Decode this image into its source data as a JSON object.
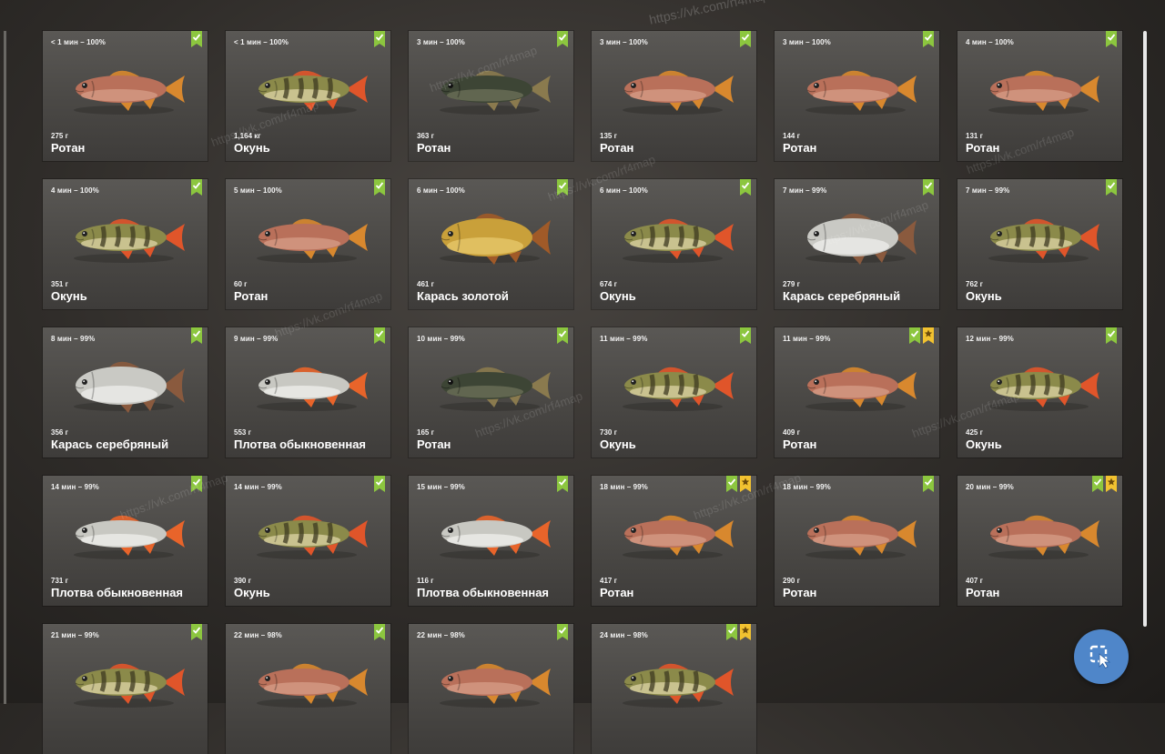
{
  "watermark": "https://vk.com/rf4map",
  "cards": [
    {
      "time": "< 1 мин – 100%",
      "weight": "275 г",
      "name": "Ротан",
      "species": "rotan",
      "star": false
    },
    {
      "time": "< 1 мин – 100%",
      "weight": "1,164 кг",
      "name": "Окунь",
      "species": "perch",
      "star": false
    },
    {
      "time": "3 мин – 100%",
      "weight": "363 г",
      "name": "Ротан",
      "species": "rotan-dark",
      "star": false
    },
    {
      "time": "3 мин – 100%",
      "weight": "135 г",
      "name": "Ротан",
      "species": "rotan",
      "star": false
    },
    {
      "time": "3 мин – 100%",
      "weight": "144 г",
      "name": "Ротан",
      "species": "rotan",
      "star": false
    },
    {
      "time": "4 мин – 100%",
      "weight": "131 г",
      "name": "Ротан",
      "species": "rotan",
      "star": false
    },
    {
      "time": "4 мин – 100%",
      "weight": "351 г",
      "name": "Окунь",
      "species": "perch",
      "star": false
    },
    {
      "time": "5 мин – 100%",
      "weight": "60 г",
      "name": "Ротан",
      "species": "rotan",
      "star": false
    },
    {
      "time": "6 мин – 100%",
      "weight": "461 г",
      "name": "Карась золотой",
      "species": "gold-carp",
      "star": false
    },
    {
      "time": "6 мин – 100%",
      "weight": "674 г",
      "name": "Окунь",
      "species": "perch",
      "star": false
    },
    {
      "time": "7 мин – 99%",
      "weight": "279 г",
      "name": "Карась серебряный",
      "species": "silver-carp",
      "star": false
    },
    {
      "time": "7 мин – 99%",
      "weight": "762 г",
      "name": "Окунь",
      "species": "perch",
      "star": false
    },
    {
      "time": "8 мин – 99%",
      "weight": "356 г",
      "name": "Карась серебряный",
      "species": "silver-carp",
      "star": false
    },
    {
      "time": "9 мин – 99%",
      "weight": "553 г",
      "name": "Плотва обыкновенная",
      "species": "roach",
      "star": false
    },
    {
      "time": "10 мин – 99%",
      "weight": "165 г",
      "name": "Ротан",
      "species": "rotan-dark",
      "star": false
    },
    {
      "time": "11 мин – 99%",
      "weight": "730 г",
      "name": "Окунь",
      "species": "perch",
      "star": false
    },
    {
      "time": "11 мин – 99%",
      "weight": "409 г",
      "name": "Ротан",
      "species": "rotan",
      "star": true
    },
    {
      "time": "12 мин – 99%",
      "weight": "425 г",
      "name": "Окунь",
      "species": "perch",
      "star": false
    },
    {
      "time": "14 мин – 99%",
      "weight": "731 г",
      "name": "Плотва обыкновенная",
      "species": "roach",
      "star": false
    },
    {
      "time": "14 мин – 99%",
      "weight": "390 г",
      "name": "Окунь",
      "species": "perch",
      "star": false
    },
    {
      "time": "15 мин – 99%",
      "weight": "116 г",
      "name": "Плотва обыкновенная",
      "species": "roach",
      "star": false
    },
    {
      "time": "18 мин – 99%",
      "weight": "417 г",
      "name": "Ротан",
      "species": "rotan",
      "star": true
    },
    {
      "time": "18 мин – 99%",
      "weight": "290 г",
      "name": "Ротан",
      "species": "rotan",
      "star": false
    },
    {
      "time": "20 мин – 99%",
      "weight": "407 г",
      "name": "Ротан",
      "species": "rotan",
      "star": true
    },
    {
      "time": "21 мин – 99%",
      "weight": "",
      "name": "",
      "species": "perch",
      "star": false
    },
    {
      "time": "22 мин – 98%",
      "weight": "",
      "name": "",
      "species": "rotan",
      "star": false
    },
    {
      "time": "22 мин – 98%",
      "weight": "",
      "name": "",
      "species": "rotan",
      "star": false
    },
    {
      "time": "24 мин – 98%",
      "weight": "",
      "name": "",
      "species": "perch",
      "star": true
    }
  ],
  "colors": {
    "check_badge": "#8cc63f",
    "star_badge": "#f2c230",
    "fab": "#4f86c9"
  }
}
